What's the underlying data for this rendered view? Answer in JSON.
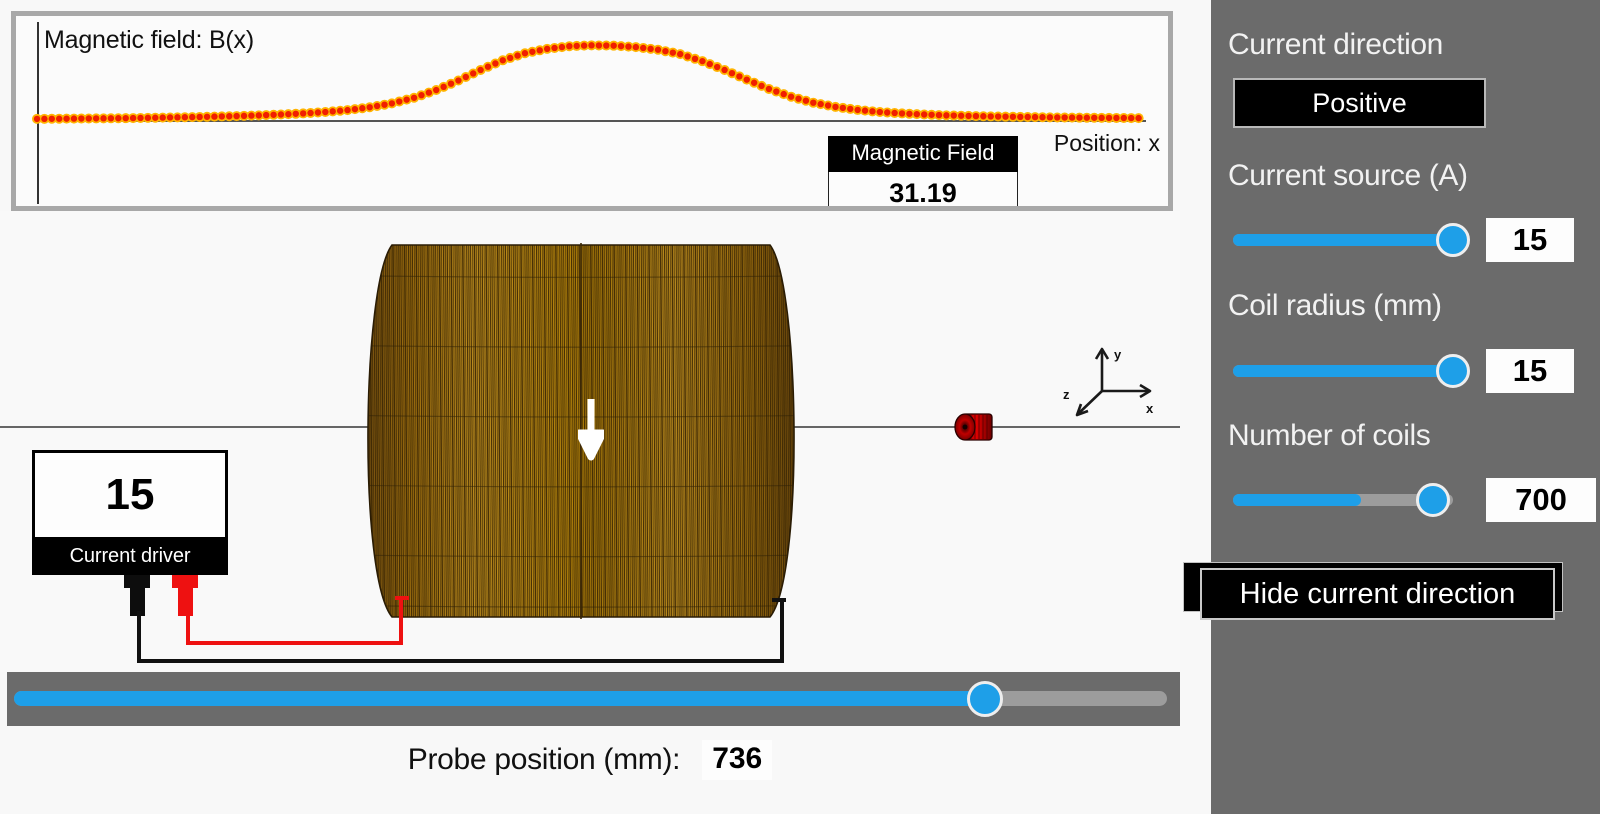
{
  "plot": {
    "title": "Magnetic field: B(x)",
    "x_axis_label": "Position: x",
    "readout_label": "Magnetic Field",
    "readout_value": "31.19"
  },
  "chart_data": {
    "type": "line",
    "title": "Magnetic field: B(x)",
    "xlabel": "Position: x",
    "ylabel": "B(x)",
    "marker": "dot",
    "marker_color": "#f01e00",
    "marker_halo_color": "#ffb400",
    "grid": false,
    "legend": null,
    "annotations": [
      {
        "label": "Magnetic Field",
        "value": "31.19"
      }
    ],
    "axis_origin_at_left": true,
    "x": [
      0,
      2,
      4,
      6,
      8,
      10,
      12,
      14,
      16,
      18,
      20,
      22,
      24,
      26,
      28,
      30,
      32,
      34,
      36,
      38,
      40,
      42,
      44,
      46,
      48,
      50,
      52,
      54,
      56,
      58,
      60,
      62,
      64,
      66,
      68,
      70,
      72,
      74,
      76,
      78,
      80,
      82,
      84,
      86,
      88,
      90,
      92,
      94,
      96,
      98,
      100
    ],
    "values": [
      1.2,
      1.3,
      1.4,
      1.5,
      1.6,
      1.8,
      2.0,
      2.2,
      2.5,
      2.8,
      3.2,
      3.7,
      4.3,
      5.1,
      6.2,
      7.8,
      10.0,
      13.2,
      17.6,
      23.0,
      29.0,
      34.5,
      38.5,
      41.0,
      42.5,
      43.0,
      42.8,
      42.0,
      40.5,
      38.0,
      34.0,
      29.0,
      23.5,
      18.2,
      13.8,
      10.4,
      8.0,
      6.3,
      5.1,
      4.3,
      3.7,
      3.2,
      2.9,
      2.6,
      2.4,
      2.2,
      2.0,
      1.9,
      1.8,
      1.7,
      1.6
    ],
    "ylim": [
      0,
      50
    ]
  },
  "current_driver": {
    "value": "15",
    "label": "Current driver",
    "terminal_negative_color": "#0d0d0d",
    "terminal_positive_color": "#ee1111"
  },
  "scene": {
    "axis_triad": {
      "x": "x",
      "y": "y",
      "z": "z"
    },
    "field_arrow_direction": "down",
    "coil_color": "#b07a18",
    "probe_color": "#c00000"
  },
  "probe_slider": {
    "label": "Probe position (mm):",
    "value": "736",
    "fill_percent": 83.4
  },
  "sidebar": {
    "current_direction": {
      "label": "Current direction",
      "button_label": "Positive"
    },
    "current_source": {
      "label": "Current source (A)",
      "value": "15",
      "fill_percent": 100
    },
    "coil_radius": {
      "label": "Coil radius (mm)",
      "value": "15",
      "fill_percent": 100
    },
    "number_of_coils": {
      "label": "Number of coils",
      "value": "700",
      "fill_percent": 58
    },
    "hide_current_direction_label": "Hide current direction",
    "accent_color": "#1e9fe8",
    "panel_color": "#6b6b6b"
  }
}
